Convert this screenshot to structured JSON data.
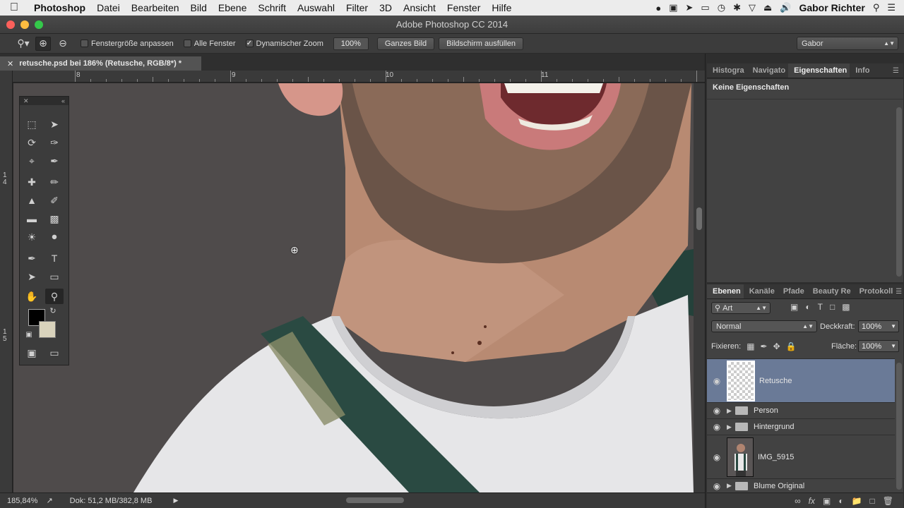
{
  "menubar": {
    "app_name": "Photoshop",
    "items": [
      "Datei",
      "Bearbeiten",
      "Bild",
      "Ebene",
      "Schrift",
      "Auswahl",
      "Filter",
      "3D",
      "Ansicht",
      "Fenster",
      "Hilfe"
    ],
    "user": "Gabor Richter"
  },
  "window": {
    "title": "Adobe Photoshop CC 2014"
  },
  "options": {
    "fit_window": "Fenstergröße anpassen",
    "all_windows": "Alle Fenster",
    "dynamic_zoom": "Dynamischer Zoom",
    "zoom_value": "100%",
    "whole_image": "Ganzes Bild",
    "fill_screen": "Bildschirm ausfüllen",
    "workspace": "Gabor"
  },
  "document": {
    "tab_title": "retusche.psd bei 186% (Retusche, RGB/8*) *"
  },
  "ruler": {
    "top_labels": [
      "8",
      "9",
      "10",
      "11"
    ],
    "left_labels": [
      "1\n4",
      "1\n5"
    ]
  },
  "status": {
    "zoom": "185,84%",
    "doc_info": "Dok: 51,2 MB/382,8 MB"
  },
  "panels": {
    "top_tabs": [
      "Histogra",
      "Navigato",
      "Eigenschaften",
      "Info"
    ],
    "properties_text": "Keine Eigenschaften",
    "layer_tabs": [
      "Ebenen",
      "Kanäle",
      "Pfade",
      "Beauty Re",
      "Protokoll"
    ]
  },
  "layers_panel": {
    "filter_kind": "Art",
    "blend_mode": "Normal",
    "opacity_label": "Deckkraft:",
    "opacity": "100%",
    "lock_label": "Fixieren:",
    "fill_label": "Fläche:",
    "fill": "100%",
    "layers": [
      {
        "name": "Retusche"
      },
      {
        "name": "Person"
      },
      {
        "name": "Hintergrund"
      },
      {
        "name": "IMG_5915"
      },
      {
        "name": "Blume Original"
      }
    ]
  },
  "colors": {
    "foreground": "#000000",
    "background": "#d9d3bc",
    "selected_layer": "#6a7a97"
  }
}
